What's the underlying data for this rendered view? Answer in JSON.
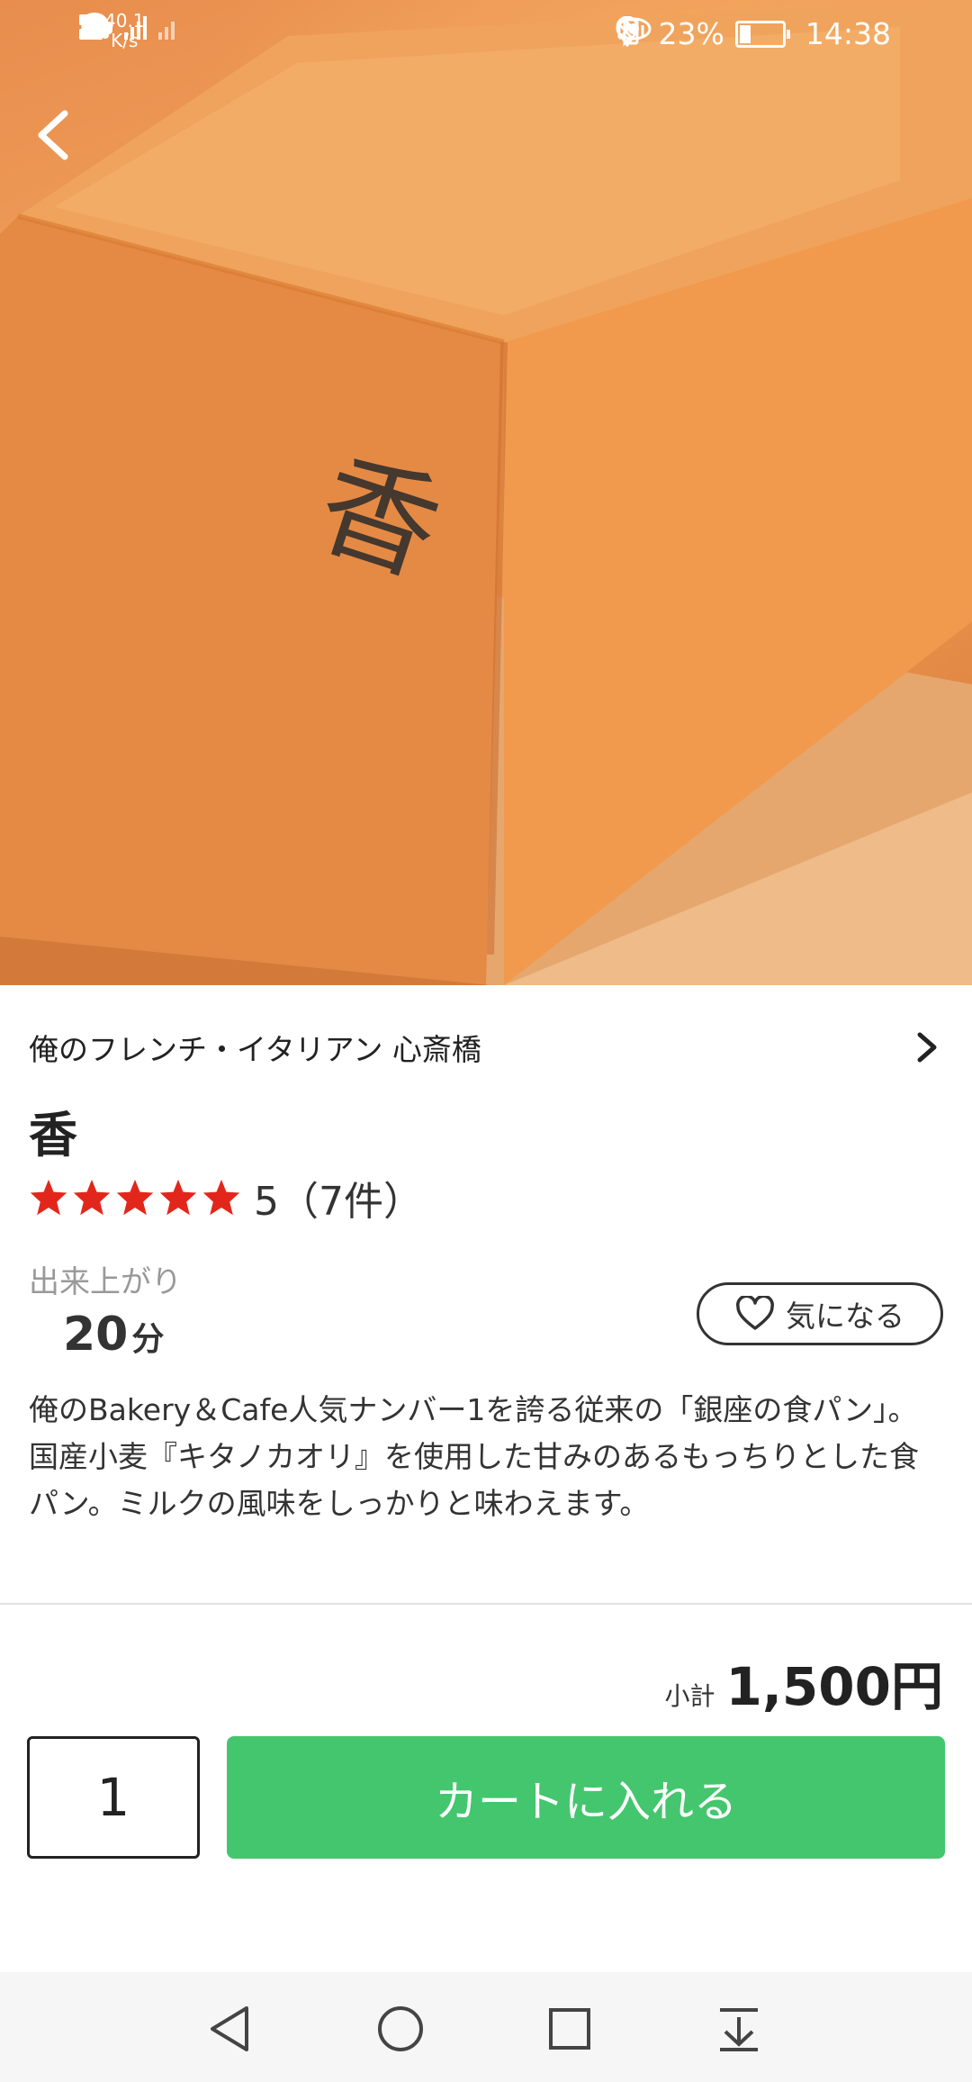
{
  "status_bar": {
    "net_speed_top": "40.1",
    "net_speed_unit": "K/s",
    "battery": "23%",
    "time": "14:38"
  },
  "shop": {
    "name": "俺のフレンチ・イタリアン 心斎橋"
  },
  "product": {
    "title": "香",
    "rating_value": 5,
    "rating_text": "5（7件）",
    "ready_label": "出来上がり",
    "ready_value": "20",
    "ready_unit": "分",
    "favorite_label": "気になる",
    "description": "俺のBakery＆Cafe人気ナンバー1を誇る従来の「銀座の食パン」。国産小麦『キタノカオリ』を使用した甘みのあるもっちりとした食パン。ミルクの風味をしっかりと味わえます。"
  },
  "cart": {
    "subtotal_label": "小計",
    "subtotal_value": "1,500円",
    "quantity": "1",
    "add_button": "カートに入れる"
  },
  "hero": {
    "stamp": "香"
  },
  "colors": {
    "accent_green": "#44c66e",
    "star_red": "#e3261b"
  }
}
